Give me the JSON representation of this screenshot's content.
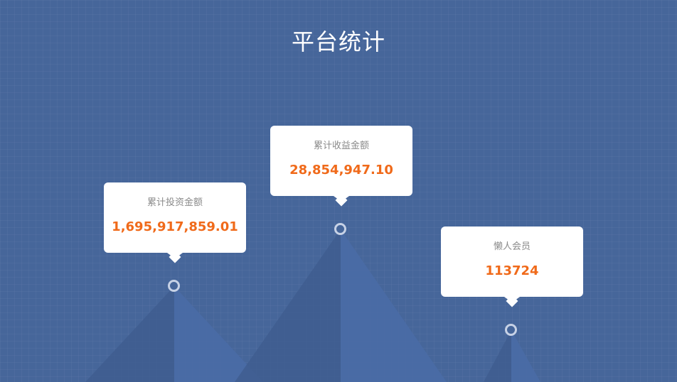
{
  "title": "平台统计",
  "stats": [
    {
      "label": "累计投资金额",
      "value": "1,695,917,859.01"
    },
    {
      "label": "累计收益金额",
      "value": "28,854,947.10"
    },
    {
      "label": "懒人会员",
      "value": "113724"
    }
  ],
  "colors": {
    "background": "#46669a",
    "value_accent": "#f06a1a",
    "label_gray": "#8a8a8a",
    "card": "#ffffff"
  }
}
